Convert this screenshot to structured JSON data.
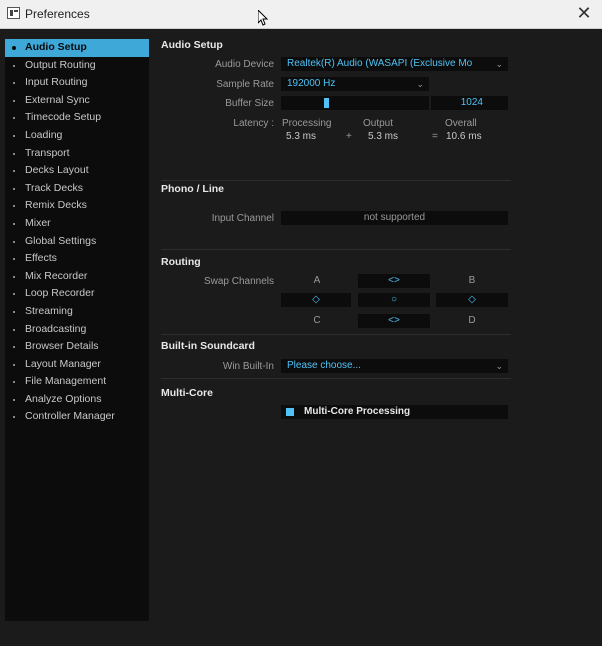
{
  "window": {
    "title": "Preferences",
    "close_symbol": "✕"
  },
  "sidebar": {
    "items": [
      {
        "label": "Audio Setup",
        "active": true
      },
      {
        "label": "Output Routing"
      },
      {
        "label": "Input Routing"
      },
      {
        "label": "External Sync"
      },
      {
        "label": "Timecode Setup"
      },
      {
        "label": "Loading"
      },
      {
        "label": "Transport"
      },
      {
        "label": "Decks Layout"
      },
      {
        "label": "Track Decks"
      },
      {
        "label": "Remix Decks"
      },
      {
        "label": "Mixer"
      },
      {
        "label": "Global Settings"
      },
      {
        "label": "Effects"
      },
      {
        "label": "Mix Recorder"
      },
      {
        "label": "Loop Recorder"
      },
      {
        "label": "Streaming"
      },
      {
        "label": "Broadcasting"
      },
      {
        "label": "Browser Details"
      },
      {
        "label": "Layout Manager"
      },
      {
        "label": "File Management"
      },
      {
        "label": "Analyze Options"
      },
      {
        "label": "Controller Manager"
      }
    ]
  },
  "audio_setup": {
    "title": "Audio Setup",
    "device_label": "Audio Device",
    "device_value": "Realtek(R) Audio (WASAPI (Exclusive Mo",
    "sample_rate_label": "Sample Rate",
    "sample_rate_value": "192000 Hz",
    "buffer_label": "Buffer Size",
    "buffer_value": "1024",
    "buffer_slider_level": 0.27,
    "latency_label": "Latency :",
    "processing_label": "Processing",
    "processing_value": "5.3 ms",
    "plus": "+",
    "output_label": "Output",
    "output_value": "5.3 ms",
    "equals": "=",
    "overall_label": "Overall",
    "overall_value": "10.6 ms"
  },
  "phono": {
    "title": "Phono / Line",
    "input_label": "Input Channel",
    "input_value": "not supported"
  },
  "routing": {
    "title": "Routing",
    "swap_label": "Swap Channels",
    "a": "A",
    "b": "B",
    "c": "C",
    "d": "D",
    "swap_h": "<>",
    "swap_v": "◇",
    "swap_center": "○"
  },
  "soundcard": {
    "title": "Built-in Soundcard",
    "label": "Win Built-In",
    "value": "Please choose..."
  },
  "multicore": {
    "title": "Multi-Core",
    "option_label": "Multi-Core Processing",
    "checked": true
  },
  "colors": {
    "accent": "#3ea8d8",
    "value_text": "#4fc3f7",
    "panel_bg": "#1b1b1b",
    "field_bg": "#0c0c0c"
  }
}
